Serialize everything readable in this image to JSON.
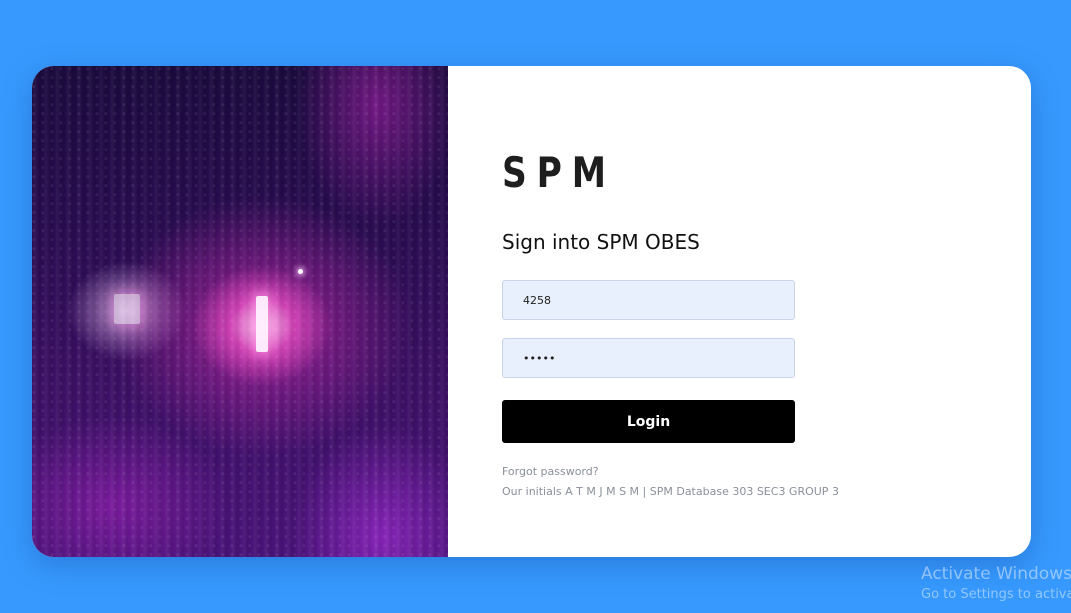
{
  "brand": {
    "logo": "SPM",
    "title": "Sign into SPM OBES"
  },
  "login_form": {
    "username_value": "4258",
    "password_value": "•••••",
    "login_label": "Login",
    "forgot_label": "Forgot password?",
    "footer_text": "Our initials A T M J M S M | SPM Database 303 SEC3 GROUP 3"
  },
  "watermark": {
    "title": "Activate Windows",
    "subtitle": "Go to Settings to activate Windows."
  },
  "colors": {
    "page_background": "#3799fd",
    "card_background": "#ffffff",
    "input_background": "#e8f0fe",
    "button_background": "#000000",
    "muted_text": "#8a8f99"
  },
  "icons": {
    "artwork": "rain-window-photo"
  }
}
